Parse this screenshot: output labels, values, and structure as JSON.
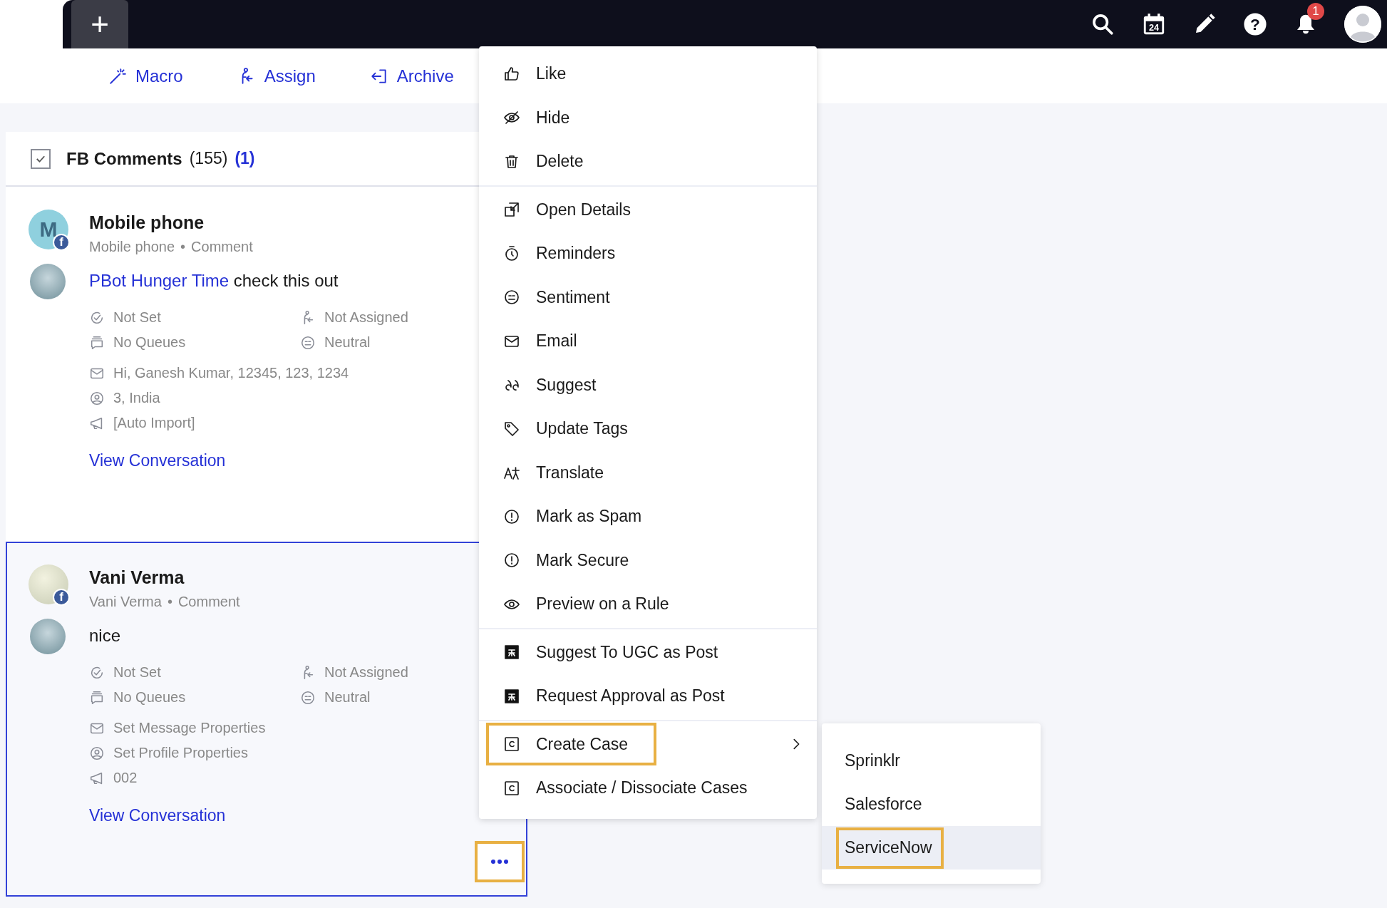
{
  "topbar": {
    "add_button": "+",
    "calendar_day": "24",
    "help_label": "?",
    "notification_count": "1"
  },
  "toolbar": [
    {
      "label": "Macro"
    },
    {
      "label": "Assign"
    },
    {
      "label": "Archive"
    }
  ],
  "panel": {
    "title": "FB Comments",
    "count": "(155)",
    "selected_count": "(1)",
    "select_all_checked": true
  },
  "messages": [
    {
      "author": "Mobile phone",
      "avatar_letter": "M",
      "network_badge": "f",
      "source": "Mobile phone",
      "separator": "•",
      "type": "Comment",
      "mention": "PBot Hunger Time",
      "text": "check this out",
      "status": "Not Set",
      "assignee": "Not Assigned",
      "queues": "No Queues",
      "sentiment": "Neutral",
      "message_properties": "Hi, Ganesh Kumar, 12345, 123, 1234",
      "profile_properties": "3, India",
      "campaign": "[Auto Import]",
      "link": "View Conversation",
      "selected": false
    },
    {
      "author": "Vani Verma",
      "network_badge": "f",
      "source": "Vani Verma",
      "separator": "•",
      "type": "Comment",
      "text": "nice",
      "status": "Not Set",
      "assignee": "Not Assigned",
      "queues": "No Queues",
      "sentiment": "Neutral",
      "message_properties": "Set Message Properties",
      "profile_properties": "Set Profile Properties",
      "campaign": "002",
      "link": "View Conversation",
      "selected": true,
      "more_highlighted": true
    }
  ],
  "menu": {
    "groups": [
      {
        "items": [
          {
            "label": "Like"
          },
          {
            "label": "Hide"
          },
          {
            "label": "Delete"
          }
        ]
      },
      {
        "items": [
          {
            "label": "Open Details"
          },
          {
            "label": "Reminders"
          },
          {
            "label": "Sentiment"
          },
          {
            "label": "Email"
          },
          {
            "label": "Suggest"
          },
          {
            "label": "Update Tags"
          },
          {
            "label": "Translate"
          },
          {
            "label": "Mark as Spam"
          },
          {
            "label": "Mark Secure"
          },
          {
            "label": "Preview on a Rule"
          }
        ]
      },
      {
        "items": [
          {
            "label": "Suggest To UGC as Post"
          },
          {
            "label": "Request Approval as Post"
          }
        ]
      },
      {
        "items": [
          {
            "label": "Create Case",
            "highlighted": true,
            "has_submenu": true
          },
          {
            "label": "Associate / Dissociate Cases",
            "highlighted": false,
            "has_submenu": false
          }
        ]
      }
    ]
  },
  "submenu": {
    "items": [
      {
        "label": "Sprinklr",
        "hovered": false,
        "highlighted": false
      },
      {
        "label": "Salesforce",
        "hovered": false,
        "highlighted": false
      },
      {
        "label": "ServiceNow",
        "hovered": true,
        "highlighted": true
      }
    ]
  }
}
